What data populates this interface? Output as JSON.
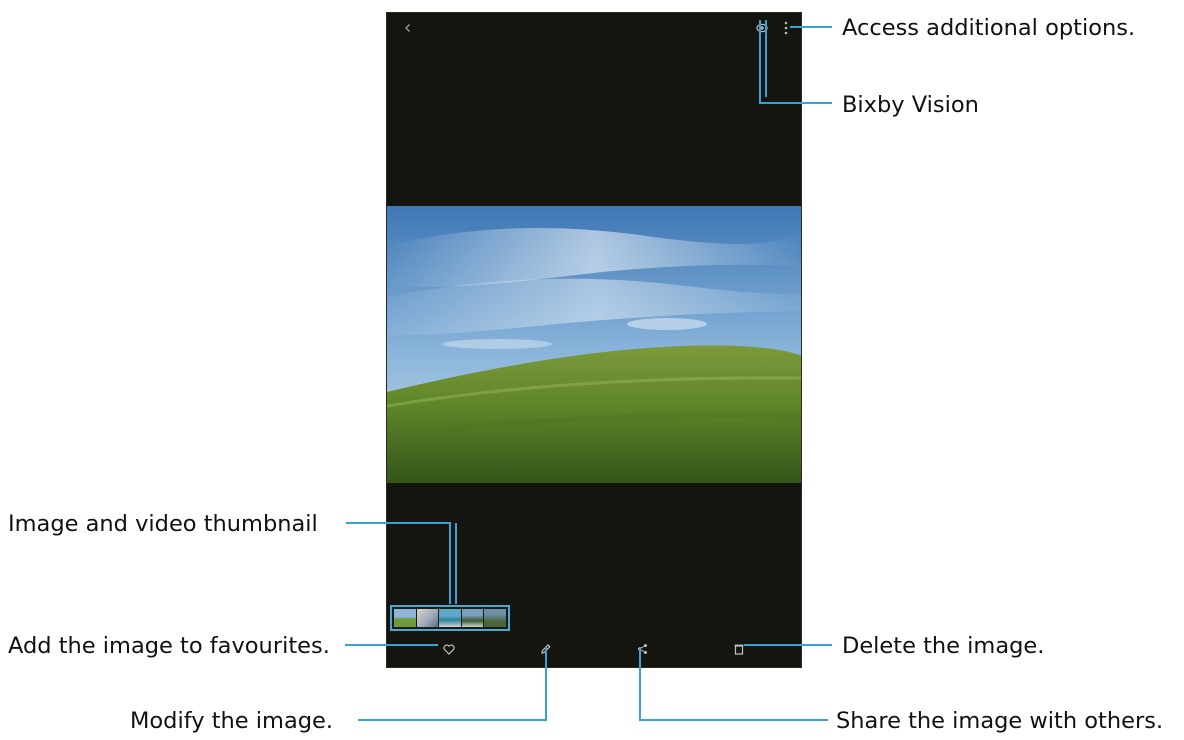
{
  "annotations": {
    "access_options": "Access additional options.",
    "bixby_vision": "Bixby Vision",
    "thumbnail": "Image and video thumbnail",
    "favourites": "Add the image to favourites.",
    "delete": "Delete the image.",
    "modify": "Modify the image.",
    "share": "Share the image with others."
  },
  "icons": {
    "back": "back-arrow-icon",
    "bixby": "bixby-vision-icon",
    "more": "more-options-icon",
    "favourite": "heart-icon",
    "edit": "pencil-icon",
    "share": "share-icon",
    "delete": "trash-icon"
  },
  "colors": {
    "screen_bg": "#14150f",
    "callout_line": "#3aa0d8",
    "thumbnail_border": "#4aa8d8"
  }
}
